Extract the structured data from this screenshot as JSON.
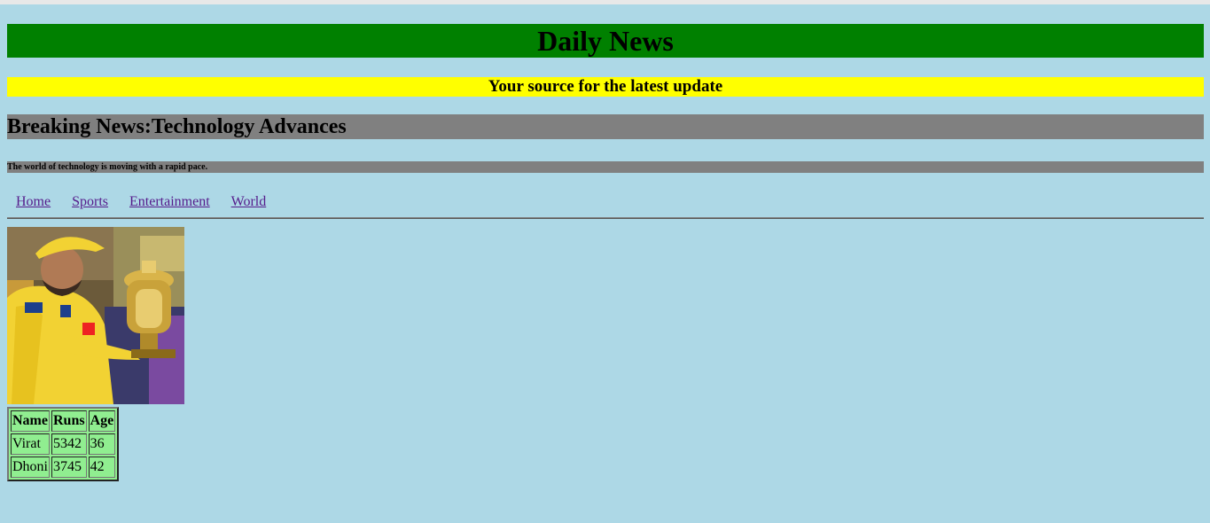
{
  "header": {
    "title": "Daily News",
    "tagline": "Your source for the latest update"
  },
  "breaking": {
    "headline": "Breaking News:Technology Advances",
    "blurb": "The world of technology is moving with a rapid pace."
  },
  "nav": {
    "items": [
      "Home",
      "Sports",
      "Entertainment",
      "World"
    ]
  },
  "image": {
    "description_icon": "cricket-captain-trophy-photo"
  },
  "table": {
    "headers": [
      "Name",
      "Runs",
      "Age"
    ],
    "rows": [
      [
        "Virat",
        "5342",
        "36"
      ],
      [
        "Dhoni",
        "3745",
        "42"
      ]
    ]
  },
  "colors": {
    "page_bg": "#add8e6",
    "title_bg": "#008000",
    "tagline_bg": "#ffff00",
    "breaking_bg": "#808080",
    "table_bg": "#90ee90",
    "link": "#551a8b"
  }
}
